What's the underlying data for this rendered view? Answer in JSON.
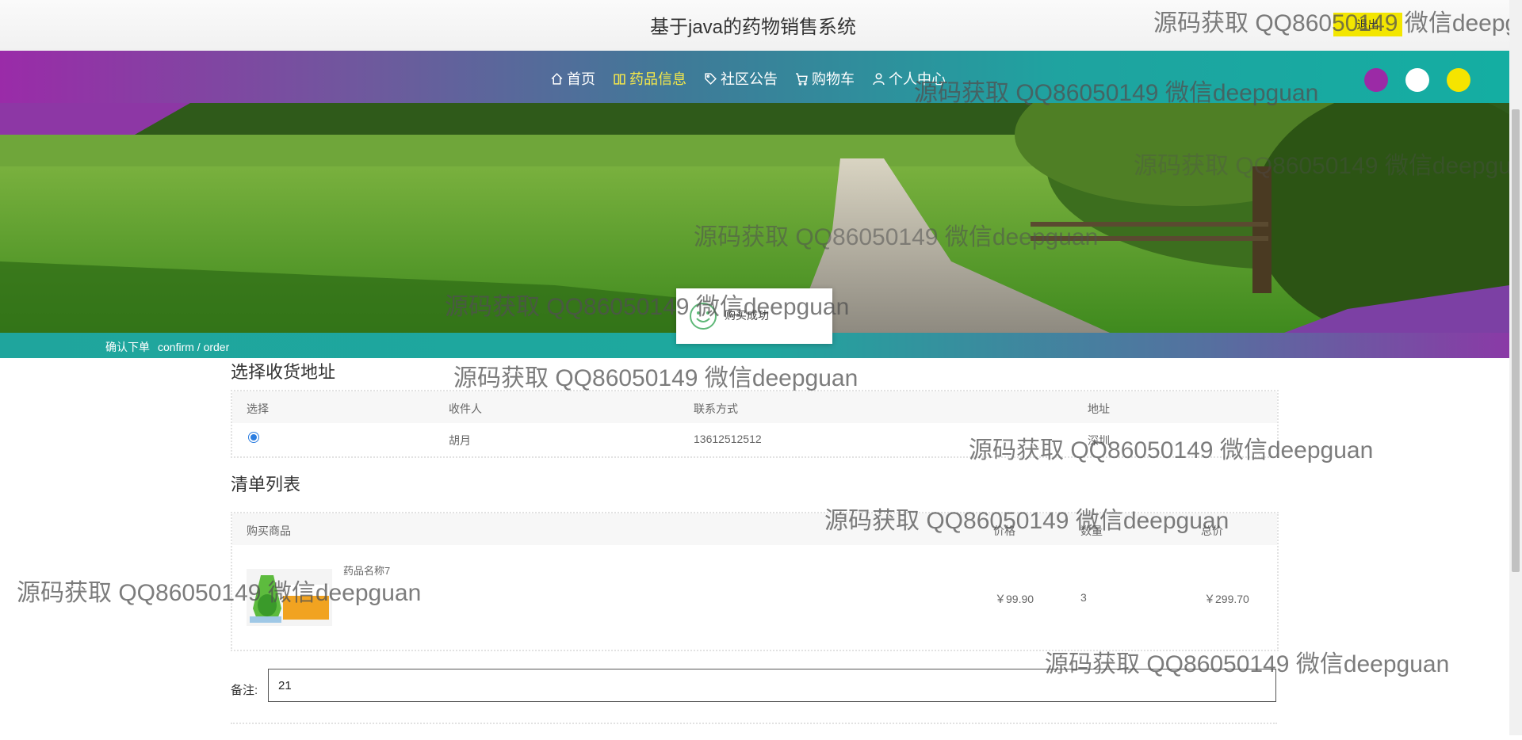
{
  "header": {
    "title": "基于java的药物销售系统",
    "logout_label": "退出"
  },
  "nav": {
    "items": [
      {
        "label": "首页",
        "icon": "home-icon"
      },
      {
        "label": "药品信息",
        "icon": "book-icon",
        "active": true
      },
      {
        "label": "社区公告",
        "icon": "tag-icon"
      },
      {
        "label": "购物车",
        "icon": "cart-icon"
      },
      {
        "label": "个人中心",
        "icon": "user-icon"
      }
    ],
    "theme_colors": [
      "#9b2aa6",
      "#ffffff",
      "#f5e400"
    ]
  },
  "breadcrumb": {
    "title": "确认下单",
    "subtitle": "confirm / order"
  },
  "toast": {
    "message": "购买成功",
    "icon": "smile-icon"
  },
  "address_section": {
    "title": "选择收货地址",
    "columns": [
      "选择",
      "收件人",
      "联系方式",
      "地址"
    ],
    "rows": [
      {
        "selected": true,
        "name": "胡月",
        "phone": "13612512512",
        "address": "深圳"
      }
    ]
  },
  "order_section": {
    "title": "清单列表",
    "columns": [
      "购买商品",
      "价格",
      "数量",
      "总价"
    ],
    "items": [
      {
        "name": "药品名称7",
        "price": "￥99.90",
        "quantity": "3",
        "total": "￥299.70"
      }
    ]
  },
  "note": {
    "label": "备注:",
    "value": "21"
  },
  "watermark": {
    "text": "源码获取 QQ86050149 微信deepguan",
    "text_cut": "源码获取 QQ86050149 微信deepg"
  },
  "colors": {
    "accent_teal": "#1fa59d",
    "accent_purple": "#9a2ba8",
    "active_nav": "#f5e84a",
    "logout_bg": "#f3e600"
  }
}
